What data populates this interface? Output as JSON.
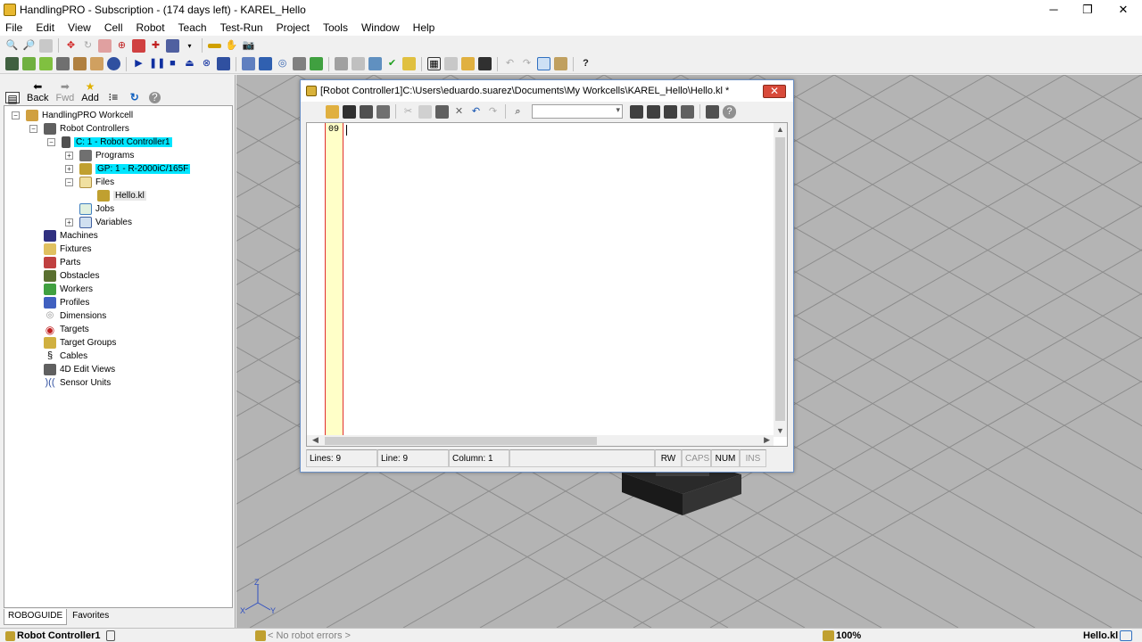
{
  "window": {
    "title": "HandlingPRO - Subscription - (174 days left) - KAREL_Hello",
    "controls": [
      "minimize-icon",
      "maximize-icon",
      "close-icon"
    ]
  },
  "menu": [
    "File",
    "Edit",
    "View",
    "Cell",
    "Robot",
    "Teach",
    "Test-Run",
    "Project",
    "Tools",
    "Window",
    "Help"
  ],
  "nav": {
    "back": "Back",
    "fwd": "Fwd",
    "add": "Add"
  },
  "tree": {
    "root": "HandlingPRO Workcell",
    "robot_controllers": "Robot Controllers",
    "controller": "C: 1 - Robot Controller1",
    "programs": "Programs",
    "gp": "GP: 1 - R-2000iC/165F",
    "files": "Files",
    "hello": "Hello.kl",
    "jobs": "Jobs",
    "variables": "Variables",
    "machines": "Machines",
    "fixtures": "Fixtures",
    "parts": "Parts",
    "obstacles": "Obstacles",
    "workers": "Workers",
    "profiles": "Profiles",
    "dimensions": "Dimensions",
    "targets": "Targets",
    "target_groups": "Target Groups",
    "cables": "Cables",
    "edit_views": "4D Edit Views",
    "sensor_units": "Sensor Units"
  },
  "pane_tabs": {
    "roboguide": "ROBOGUIDE",
    "favorites": "Favorites"
  },
  "editor": {
    "title": "[Robot Controller1]C:\\Users\\eduardo.suarez\\Documents\\My Workcells\\KAREL_Hello\\Hello.kl *",
    "close_symbol": "✕",
    "line_number": "09",
    "status": {
      "lines": "Lines: 9",
      "line": "Line: 9",
      "column": "Column: 1",
      "rw": "RW",
      "caps": "CAPS",
      "num": "NUM",
      "ins": "INS"
    }
  },
  "axis": {
    "z": "Z",
    "x": "X",
    "y": "Y"
  },
  "statusbar": {
    "controller": "Robot Controller1",
    "errors": "< No robot errors >",
    "zoom": "100%",
    "file": "Hello.kl"
  },
  "colors": {
    "highlight": "#00e5ff",
    "viewport": "#b4b4b4",
    "grid_line": "#8c8c8c",
    "gutter": "#ffffc8",
    "gutter_border": "#e03030",
    "close_button": "#d84a3a"
  }
}
